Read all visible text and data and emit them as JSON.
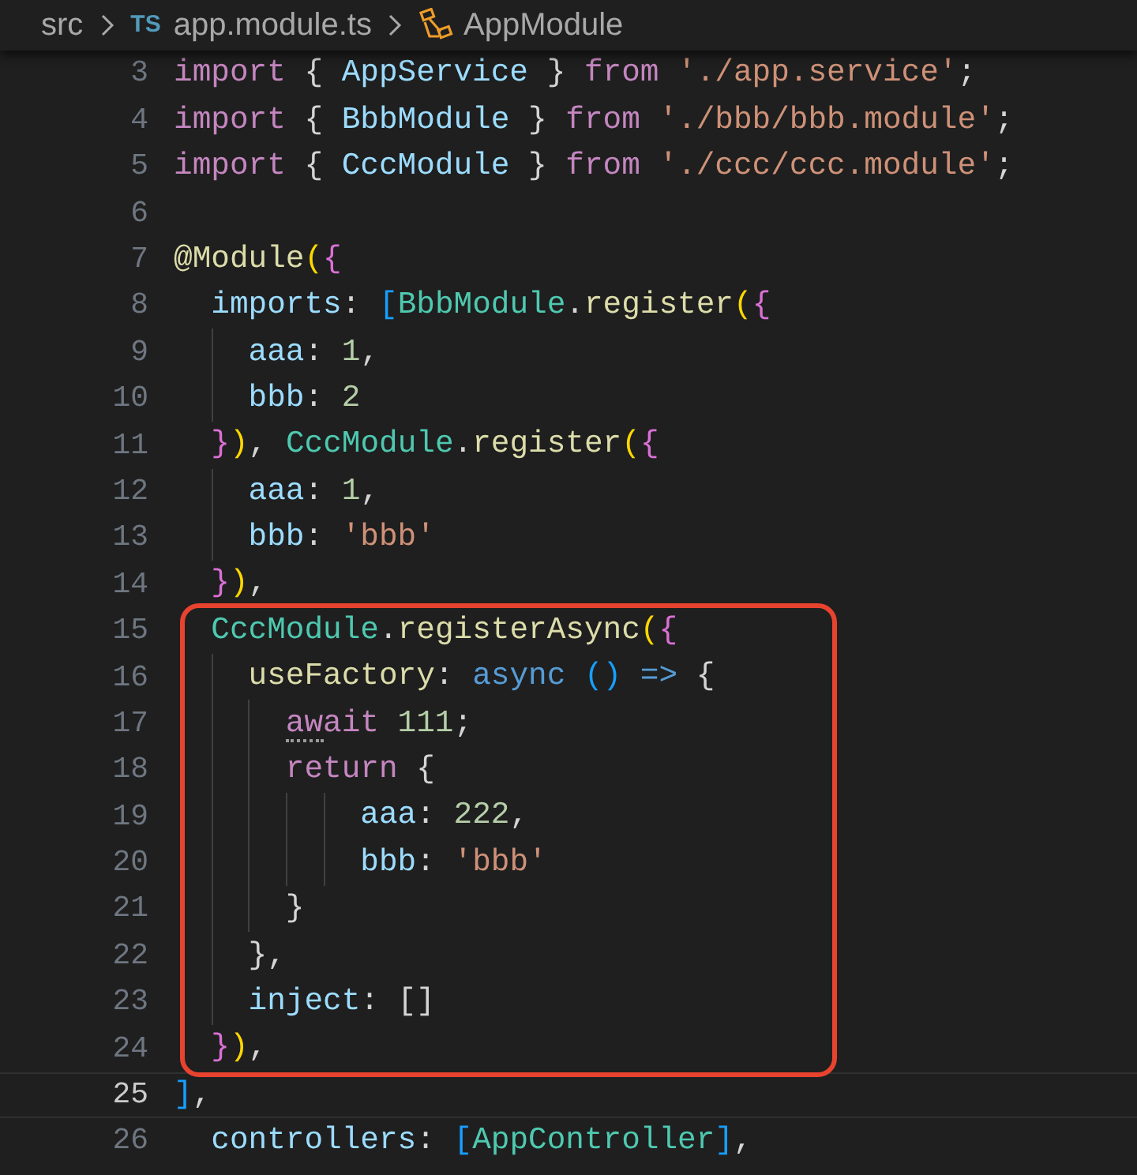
{
  "breadcrumbs": {
    "folder": "src",
    "file_badge": "TS",
    "file": "app.module.ts",
    "symbol": "AppModule"
  },
  "lines": [
    {
      "number": "3",
      "current": false,
      "tokens": [
        {
          "text": "import",
          "kind": "kw"
        },
        {
          "text": " { ",
          "kind": "punct"
        },
        {
          "text": "AppService",
          "kind": "var"
        },
        {
          "text": " } ",
          "kind": "punct"
        },
        {
          "text": "from ",
          "kind": "kw"
        },
        {
          "text": "'./app.service'",
          "kind": "str"
        },
        {
          "text": ";",
          "kind": "punct"
        }
      ]
    },
    {
      "number": "4",
      "current": false,
      "tokens": [
        {
          "text": "import",
          "kind": "kw"
        },
        {
          "text": " { ",
          "kind": "punct"
        },
        {
          "text": "BbbModule",
          "kind": "var"
        },
        {
          "text": " } ",
          "kind": "punct"
        },
        {
          "text": "from ",
          "kind": "kw"
        },
        {
          "text": "'./bbb/bbb.module'",
          "kind": "str"
        },
        {
          "text": ";",
          "kind": "punct"
        }
      ]
    },
    {
      "number": "5",
      "current": false,
      "tokens": [
        {
          "text": "import",
          "kind": "kw"
        },
        {
          "text": " { ",
          "kind": "punct"
        },
        {
          "text": "CccModule",
          "kind": "var"
        },
        {
          "text": " } ",
          "kind": "punct"
        },
        {
          "text": "from ",
          "kind": "kw"
        },
        {
          "text": "'./ccc/ccc.module'",
          "kind": "str"
        },
        {
          "text": ";",
          "kind": "punct"
        }
      ]
    },
    {
      "number": "6",
      "current": false
    },
    {
      "number": "7",
      "current": false,
      "tokens": [
        {
          "text": "@Module",
          "kind": "fn"
        },
        {
          "text": "(",
          "kind": "b1"
        },
        {
          "text": "{",
          "kind": "b2"
        }
      ]
    },
    {
      "number": "8",
      "current": false,
      "tokens": [
        {
          "text": "  imports",
          "kind": "var"
        },
        {
          "text": ": ",
          "kind": "punct"
        },
        {
          "text": "[",
          "kind": "b3"
        },
        {
          "text": "BbbModule",
          "kind": "cls"
        },
        {
          "text": ".",
          "kind": "punct"
        },
        {
          "text": "register",
          "kind": "fn"
        },
        {
          "text": "(",
          "kind": "b1"
        },
        {
          "text": "{",
          "kind": "b2"
        }
      ]
    },
    {
      "number": "9",
      "current": false,
      "tokens": [
        {
          "text": "    aaa",
          "kind": "var"
        },
        {
          "text": ": ",
          "kind": "punct"
        },
        {
          "text": "1",
          "kind": "num"
        },
        {
          "text": ",",
          "kind": "punct"
        }
      ]
    },
    {
      "number": "10",
      "current": false,
      "tokens": [
        {
          "text": "    bbb",
          "kind": "var"
        },
        {
          "text": ": ",
          "kind": "punct"
        },
        {
          "text": "2",
          "kind": "num"
        }
      ]
    },
    {
      "number": "11",
      "current": false,
      "tokens": [
        {
          "text": "  }",
          "kind": "b2"
        },
        {
          "text": ")",
          "kind": "b1"
        },
        {
          "text": ", ",
          "kind": "punct"
        },
        {
          "text": "CccModule",
          "kind": "cls"
        },
        {
          "text": ".",
          "kind": "punct"
        },
        {
          "text": "register",
          "kind": "fn"
        },
        {
          "text": "(",
          "kind": "b1"
        },
        {
          "text": "{",
          "kind": "b2"
        }
      ]
    },
    {
      "number": "12",
      "current": false,
      "tokens": [
        {
          "text": "    aaa",
          "kind": "var"
        },
        {
          "text": ": ",
          "kind": "punct"
        },
        {
          "text": "1",
          "kind": "num"
        },
        {
          "text": ",",
          "kind": "punct"
        }
      ]
    },
    {
      "number": "13",
      "current": false,
      "tokens": [
        {
          "text": "    bbb",
          "kind": "var"
        },
        {
          "text": ": ",
          "kind": "punct"
        },
        {
          "text": "'bbb'",
          "kind": "str"
        }
      ]
    },
    {
      "number": "14",
      "current": false,
      "tokens": [
        {
          "text": "  }",
          "kind": "b2"
        },
        {
          "text": ")",
          "kind": "b1"
        },
        {
          "text": ",",
          "kind": "punct"
        }
      ]
    },
    {
      "number": "15",
      "current": false,
      "tokens": [
        {
          "text": "  CccModule",
          "kind": "cls"
        },
        {
          "text": ".",
          "kind": "punct"
        },
        {
          "text": "registerAsync",
          "kind": "fn"
        },
        {
          "text": "(",
          "kind": "b1"
        },
        {
          "text": "{",
          "kind": "b2"
        }
      ]
    },
    {
      "number": "16",
      "current": false,
      "tokens": [
        {
          "text": "    useFactory",
          "kind": "fn"
        },
        {
          "text": ": ",
          "kind": "punct"
        },
        {
          "text": "async ",
          "kind": "storage"
        },
        {
          "text": "() ",
          "kind": "b3"
        },
        {
          "text": "=>",
          "kind": "storage"
        },
        {
          "text": " {",
          "kind": "punct"
        }
      ]
    },
    {
      "number": "17",
      "current": false,
      "tokens": [
        {
          "text": "      await",
          "kind": "kw",
          "hinted": true
        },
        {
          "text": " 111",
          "kind": "num"
        },
        {
          "text": ";",
          "kind": "punct"
        }
      ]
    },
    {
      "number": "18",
      "current": false,
      "tokens": [
        {
          "text": "      return",
          "kind": "kw"
        },
        {
          "text": " {",
          "kind": "punct"
        }
      ]
    },
    {
      "number": "19",
      "current": false,
      "tokens": [
        {
          "text": "          aaa",
          "kind": "var"
        },
        {
          "text": ": ",
          "kind": "punct"
        },
        {
          "text": "222",
          "kind": "num"
        },
        {
          "text": ",",
          "kind": "punct"
        }
      ]
    },
    {
      "number": "20",
      "current": false,
      "tokens": [
        {
          "text": "          bbb",
          "kind": "var"
        },
        {
          "text": ": ",
          "kind": "punct"
        },
        {
          "text": "'bbb'",
          "kind": "str"
        }
      ]
    },
    {
      "number": "21",
      "current": false,
      "tokens": [
        {
          "text": "      }",
          "kind": "punct"
        }
      ]
    },
    {
      "number": "22",
      "current": false,
      "tokens": [
        {
          "text": "    },",
          "kind": "punct"
        }
      ]
    },
    {
      "number": "23",
      "current": false,
      "tokens": [
        {
          "text": "    inject",
          "kind": "var"
        },
        {
          "text": ": ",
          "kind": "punct"
        },
        {
          "text": "[]",
          "kind": "punct"
        }
      ]
    },
    {
      "number": "24",
      "current": false,
      "tokens": [
        {
          "text": "  }",
          "kind": "b2"
        },
        {
          "text": ")",
          "kind": "b1"
        },
        {
          "text": ",",
          "kind": "punct"
        }
      ]
    },
    {
      "number": "25",
      "current": true,
      "tokens": [
        {
          "text": "]",
          "kind": "b3"
        },
        {
          "text": ",",
          "kind": "punct"
        }
      ]
    },
    {
      "number": "26",
      "current": false,
      "tokens": [
        {
          "text": "  controllers",
          "kind": "var"
        },
        {
          "text": ": ",
          "kind": "punct"
        },
        {
          "text": "[",
          "kind": "b3"
        },
        {
          "text": "AppController",
          "kind": "cls"
        },
        {
          "text": "]",
          "kind": "b3"
        },
        {
          "text": ",",
          "kind": "punct"
        }
      ]
    }
  ]
}
